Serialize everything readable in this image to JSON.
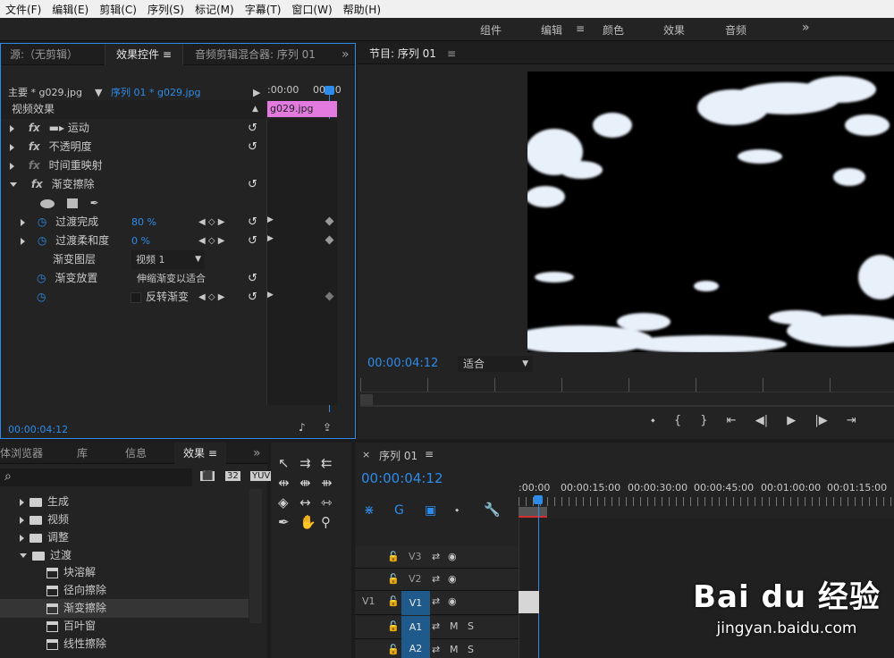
{
  "menu": [
    "文件(F)",
    "编辑(E)",
    "剪辑(C)",
    "序列(S)",
    "标记(M)",
    "字幕(T)",
    "窗口(W)",
    "帮助(H)"
  ],
  "workspaces": {
    "w1": "组件",
    "w2": "编辑",
    "w3": "颜色",
    "w4": "效果",
    "w5": "音频",
    "more": "»"
  },
  "source_panel": {
    "tab_source": "源:（无剪辑）",
    "tab_effects": "效果控件",
    "tab_audio_mixer": "音频剪辑混合器: 序列 01",
    "more": "»",
    "master": "主要 * g029.jpg",
    "sequence": "序列 01 * g029.jpg",
    "ruler_start": ":00:00",
    "ruler_end": "00:00",
    "clip_name": "g029.jpg",
    "video_effects": "视频效果",
    "motion": "运动",
    "opacity": "不透明度",
    "time_remap": "时间重映射",
    "gradient_wipe": "渐变擦除",
    "fx": "fx",
    "transition_complete": "过渡完成",
    "transition_complete_val": "80 %",
    "transition_softness": "过渡柔和度",
    "transition_softness_val": "0 %",
    "gradient_layer": "渐变图层",
    "gradient_layer_val": "视频 1",
    "gradient_placement": "渐变放置",
    "gradient_placement_val": "伸缩渐变以适合",
    "invert": "反转渐变",
    "timecode": "00:00:04:12"
  },
  "program": {
    "title": "节目: 序列 01",
    "timecode": "00:00:04:12",
    "fit": "适合"
  },
  "project": {
    "tab_media": "体浏览器",
    "tab_library": "库",
    "tab_info": "信息",
    "tab_effects": "效果",
    "more": "»",
    "search_icon": "⌕",
    "folders": [
      "生成",
      "视频",
      "调整",
      "过渡"
    ],
    "items": [
      "块溶解",
      "径向擦除",
      "渐变擦除",
      "百叶窗",
      "线性擦除"
    ]
  },
  "timeline": {
    "title": "序列 01",
    "timecode": "00:00:04:12",
    "ticks": [
      ":00:00",
      "00:00:15:00",
      "00:00:30:00",
      "00:00:45:00",
      "00:01:00:00",
      "00:01:15:00"
    ],
    "tracks": [
      {
        "name": "V3"
      },
      {
        "name": "V2"
      },
      {
        "name": "V1",
        "src": "V1"
      },
      {
        "name": "A1",
        "m": "M",
        "s": "S"
      },
      {
        "name": "A2",
        "m": "M",
        "s": "S"
      }
    ]
  },
  "watermark": {
    "brand": "Bai du 经验",
    "url": "jingyan.baidu.com"
  }
}
